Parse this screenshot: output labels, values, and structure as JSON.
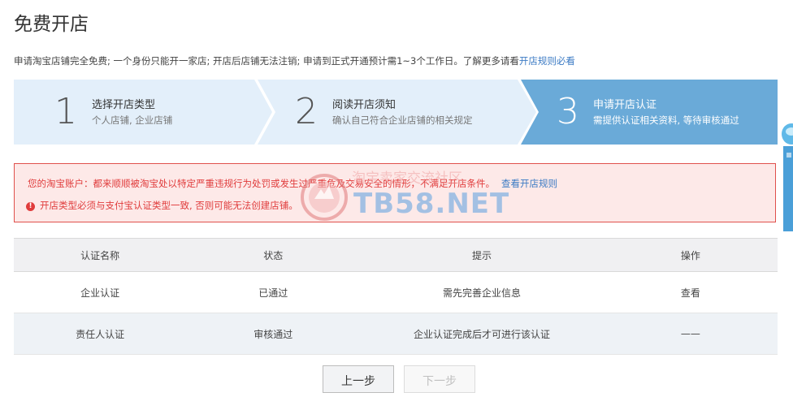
{
  "page": {
    "title": "免费开店",
    "description": "申请淘宝店铺完全免费; 一个身份只能开一家店; 开店后店铺无法注销; 申请到正式开通预计需1~3个工作日。了解更多请看",
    "rules_link": "开店规则必看"
  },
  "steps": [
    {
      "number": "1",
      "title": "选择开店类型",
      "subtitle": "个人店铺, 企业店铺",
      "active": false
    },
    {
      "number": "2",
      "title": "阅读开店须知",
      "subtitle": "确认自己符合企业店铺的相关规定",
      "active": false
    },
    {
      "number": "3",
      "title": "申请开店认证",
      "subtitle": "需提供认证相关资料, 等待审核通过",
      "active": true
    }
  ],
  "alert": {
    "message": "您的淘宝账户：都来顺顺被淘宝处以特定严重违规行为处罚或发生过严重危及交易安全的情形，不满足开店条件。",
    "link": "查看开店规则",
    "warning": "开店类型必须与支付宝认证类型一致, 否则可能无法创建店铺。"
  },
  "watermark": {
    "line1": "淘宝卖家交流社区",
    "line2": "TB58.NET"
  },
  "table": {
    "headers": [
      "认证名称",
      "状态",
      "提示",
      "操作"
    ],
    "rows": [
      {
        "name": "企业认证",
        "status": "已通过",
        "hint": "需先完善企业信息",
        "action": "查看"
      },
      {
        "name": "责任人认证",
        "status": "审核通过",
        "hint": "企业认证完成后才可进行该认证",
        "action": "——"
      }
    ]
  },
  "buttons": {
    "prev": "上一步",
    "next": "下一步"
  },
  "colors": {
    "step_inactive": "#e3effa",
    "step_active": "#6aaad8",
    "alert_bg": "#fde9e8",
    "alert_border": "#e0504c",
    "success": "#5aa53c",
    "link": "#3c7bc4"
  }
}
